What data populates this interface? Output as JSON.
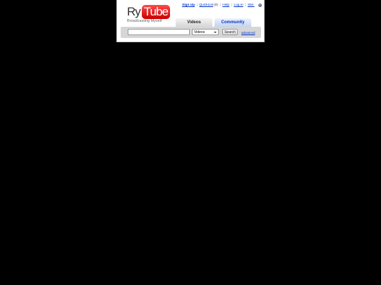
{
  "logo": {
    "prefix": "Ry",
    "box_text": "Tube",
    "tagline": "Broadcasting Myself"
  },
  "utility": {
    "sign_up": "Sign Up",
    "quicklist": "QuickList",
    "quicklist_count": "(0)",
    "help": "Help",
    "log_in": "Log In",
    "site": "Site:",
    "globe_icon": "globe-icon"
  },
  "tabs": {
    "videos": "Videos",
    "community": "Community"
  },
  "search": {
    "query": "",
    "placeholder": "",
    "category_selected": "Videos",
    "button": "Search",
    "advanced": "advanced"
  },
  "colors": {
    "page_background": "#000000",
    "logo_red": "#cc0000",
    "link_blue": "#0033cc"
  }
}
